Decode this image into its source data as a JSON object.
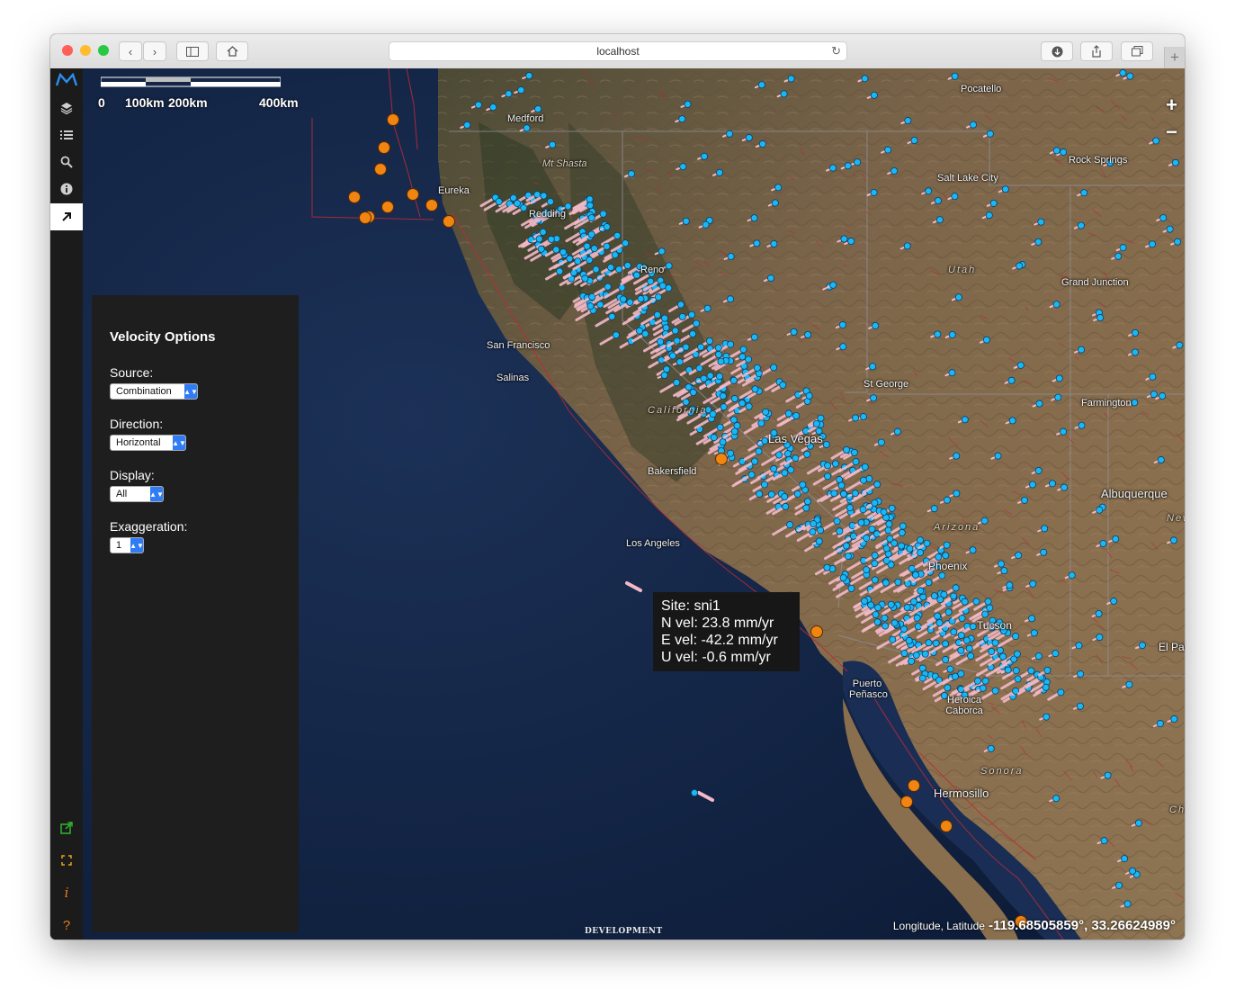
{
  "browser": {
    "url": "localhost"
  },
  "app": {
    "logo": "M",
    "tools": [
      {
        "icon": "layers-icon"
      },
      {
        "icon": "list-icon"
      },
      {
        "icon": "search-icon"
      },
      {
        "icon": "info-icon"
      },
      {
        "icon": "arrow-icon",
        "active": true
      }
    ],
    "bottom_tools": [
      {
        "icon": "external-link-icon",
        "color": "#2fb52f"
      },
      {
        "icon": "fullscreen-icon",
        "color": "#e3a21a"
      },
      {
        "icon": "italic-info-icon",
        "color": "#e37a1a",
        "glyph": "i"
      },
      {
        "icon": "help-icon",
        "color": "#e37a1a",
        "glyph": "?"
      }
    ]
  },
  "map": {
    "scale_labels": [
      "0",
      "100km",
      "200km",
      "400km"
    ],
    "zoom_in": "+",
    "zoom_out": "−",
    "places": [
      "Pocatello",
      "Medford",
      "Mt Shasta",
      "Salt Lake City",
      "Rock Springs",
      "Eureka",
      "Redding",
      "Reno",
      "Utah",
      "Grand Junction",
      "St George",
      "Farmington",
      "California",
      "Las Vegas",
      "Bakersfield",
      "Albuquerque",
      "Arizona",
      "New",
      "Los Angeles",
      "Phoenix",
      "Tucson",
      "El Paso",
      "Puerto Peñasco",
      "Heroica Caborca",
      "Sonora",
      "Hermosillo",
      "Chi",
      "San Francisco",
      "Salinas"
    ],
    "coordinate_label": "Longitude, Latitude",
    "coordinate_value": "-119.68505859°, 33.26624989°",
    "environment_tag": "DEVELOPMENT",
    "colors": {
      "gps_station": "#19b8f5",
      "velocity_arrow": "#f3b9c8",
      "earthquake": "#f08512",
      "fault": "#c12a36"
    }
  },
  "velocity_panel": {
    "title": "Velocity Options",
    "source_label": "Source:",
    "source_value": "Combination",
    "direction_label": "Direction:",
    "direction_value": "Horizontal",
    "display_label": "Display:",
    "display_value": "All",
    "exaggeration_label": "Exaggeration:",
    "exaggeration_value": "1"
  },
  "tooltip": {
    "site": "Site: sni1",
    "n_vel": "N vel: 23.8 mm/yr",
    "e_vel": "E vel: -42.2 mm/yr",
    "u_vel": "U vel: -0.6 mm/yr"
  }
}
